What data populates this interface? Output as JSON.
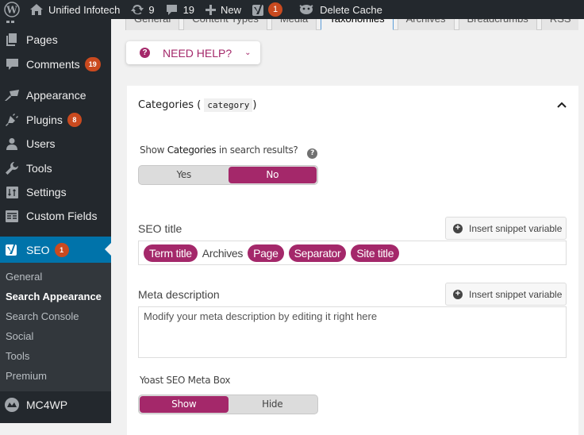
{
  "admin_bar": {
    "site_name": "Unified Infotech",
    "updates_count": "9",
    "comments_count": "19",
    "new_label": "New",
    "seo_badge": "1",
    "delete_cache_label": "Delete Cache"
  },
  "sidebar": {
    "items": [
      {
        "label": "Pages",
        "icon": "pages-icon"
      },
      {
        "label": "Comments",
        "icon": "comments-icon",
        "badge": "19"
      },
      {
        "label": "Appearance",
        "icon": "appearance-icon"
      },
      {
        "label": "Plugins",
        "icon": "plugins-icon",
        "badge": "8"
      },
      {
        "label": "Users",
        "icon": "users-icon"
      },
      {
        "label": "Tools",
        "icon": "tools-icon"
      },
      {
        "label": "Settings",
        "icon": "settings-icon"
      },
      {
        "label": "Custom Fields",
        "icon": "custom-fields-icon"
      }
    ],
    "seo": {
      "label": "SEO",
      "badge": "1"
    },
    "seo_submenu": [
      {
        "label": "General"
      },
      {
        "label": "Search Appearance",
        "current": true
      },
      {
        "label": "Search Console"
      },
      {
        "label": "Social"
      },
      {
        "label": "Tools"
      },
      {
        "label": "Premium"
      }
    ],
    "mc4wp": {
      "label": "MC4WP"
    }
  },
  "tabs": [
    {
      "label": "General"
    },
    {
      "label": "Content Types"
    },
    {
      "label": "Media"
    },
    {
      "label": "Taxonomies",
      "active": true
    },
    {
      "label": "Archives"
    },
    {
      "label": "Breadcrumbs"
    },
    {
      "label": "RSS"
    }
  ],
  "help": {
    "label": "NEED HELP?"
  },
  "panel": {
    "title": "Categories (",
    "slug": "category",
    "title_close": ")",
    "show_in_results": {
      "prefix": "Show ",
      "strong": "Categories",
      "suffix": " in search results?",
      "options": [
        "Yes",
        "No"
      ],
      "selected": "No"
    },
    "seo_title": {
      "label": "SEO title",
      "insert_button": "Insert snippet variable",
      "tokens": [
        {
          "type": "chip",
          "text": "Term title"
        },
        {
          "type": "text",
          "text": "Archives"
        },
        {
          "type": "chip",
          "text": "Page"
        },
        {
          "type": "chip",
          "text": "Separator"
        },
        {
          "type": "chip",
          "text": "Site title"
        }
      ]
    },
    "meta_description": {
      "label": "Meta description",
      "insert_button": "Insert snippet variable",
      "placeholder": "Modify your meta description by editing it right here"
    },
    "meta_box": {
      "label": "Yoast SEO Meta Box",
      "options": [
        "Show",
        "Hide"
      ],
      "selected": "Show"
    }
  },
  "colors": {
    "accent": "#a4286a",
    "admin_dark": "#23282d",
    "wp_blue": "#0073aa",
    "badge": "#ca4a1f"
  }
}
